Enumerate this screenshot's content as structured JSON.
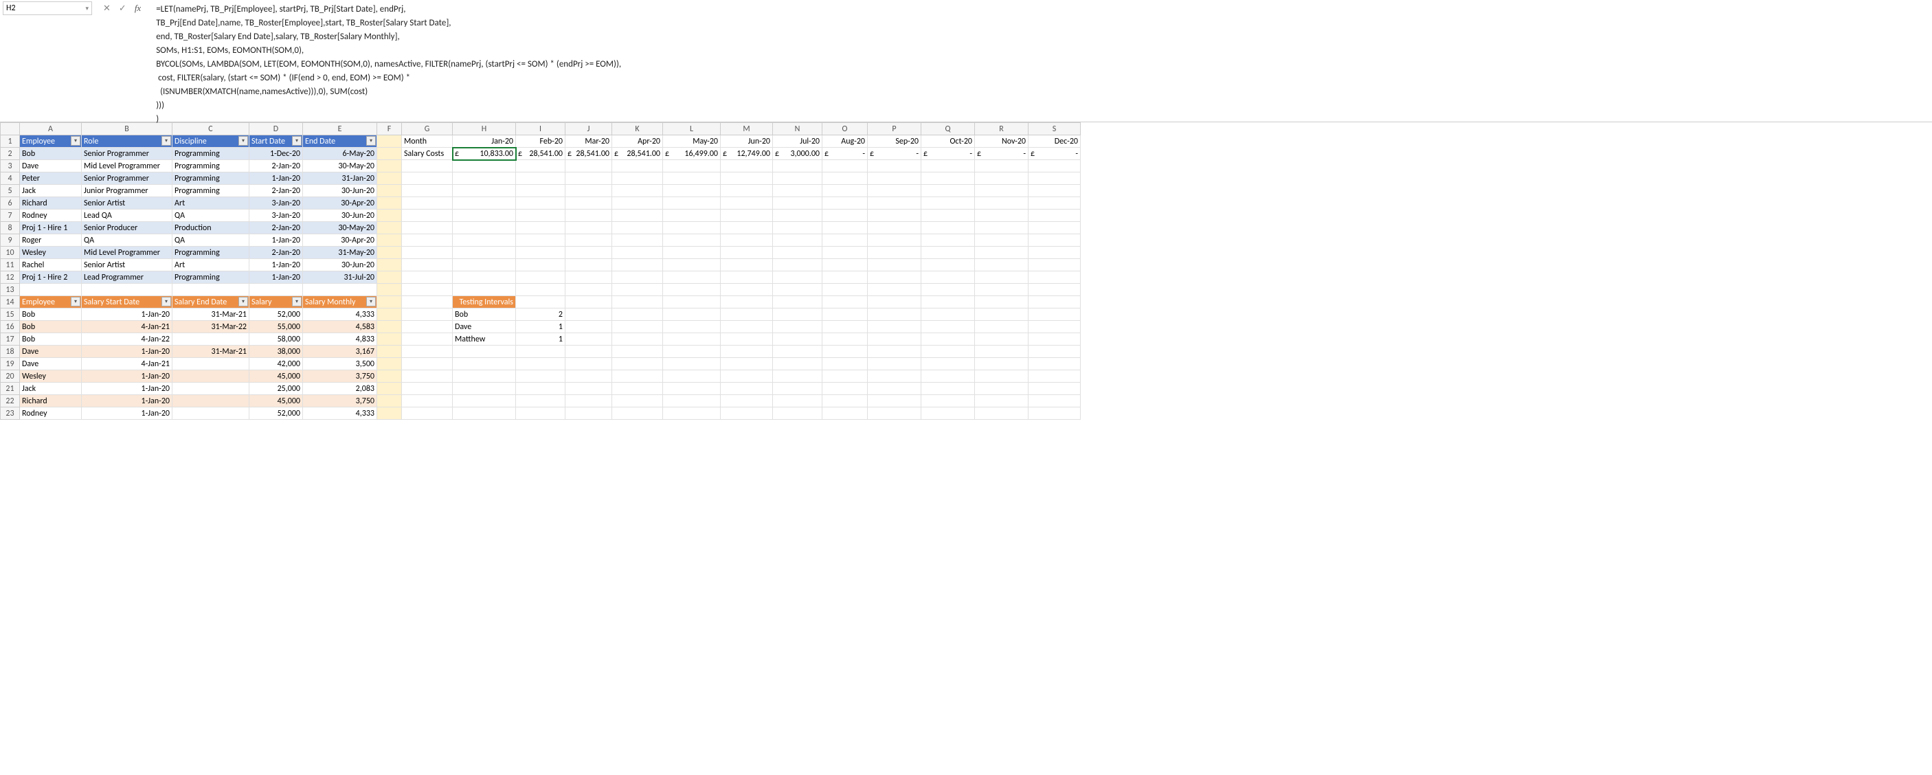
{
  "namebox": "H2",
  "formula": "=LET(namePrj, TB_Prj[Employee], startPrj, TB_Prj[Start Date], endPrj,\nTB_Prj[End Date],name, TB_Roster[Employee],start, TB_Roster[Salary Start Date],\nend, TB_Roster[Salary End Date],salary, TB_Roster[Salary Monthly],\nSOMs, H1:S1, EOMs, EOMONTH(SOM,0),\nBYCOL(SOMs, LAMBDA(SOM, LET(EOM, EOMONTH(SOM,0), namesActive, FILTER(namePrj, (startPrj <= SOM) * (endPrj >= EOM)),\n cost, FILTER(salary, (start <= SOM) * (IF(end > 0, end, EOM) >= EOM) *\n  (ISNUMBER(XMATCH(name,namesActive))),0), SUM(cost)\n)))\n)",
  "columns": [
    "A",
    "B",
    "C",
    "D",
    "E",
    "F",
    "G",
    "H",
    "I",
    "J",
    "K",
    "L",
    "M",
    "N",
    "O",
    "P",
    "Q",
    "R",
    "S"
  ],
  "table1": {
    "headers": [
      "Employee",
      "Role",
      "Discipline",
      "Start Date",
      "End Date"
    ],
    "rows": [
      [
        "Bob",
        "Senior Programmer",
        "Programming",
        "1-Dec-20",
        "6-May-20"
      ],
      [
        "Dave",
        "Mid Level Programmer",
        "Programming",
        "2-Jan-20",
        "30-May-20"
      ],
      [
        "Peter",
        "Senior Programmer",
        "Programming",
        "1-Jan-20",
        "31-Jan-20"
      ],
      [
        "Jack",
        "Junior Programmer",
        "Programming",
        "2-Jan-20",
        "30-Jun-20"
      ],
      [
        "Richard",
        "Senior Artist",
        "Art",
        "3-Jan-20",
        "30-Apr-20"
      ],
      [
        "Rodney",
        "Lead QA",
        "QA",
        "3-Jan-20",
        "30-Jun-20"
      ],
      [
        "Proj 1 - Hire 1",
        "Senior Producer",
        "Production",
        "2-Jan-20",
        "30-May-20"
      ],
      [
        "Roger",
        "QA",
        "QA",
        "1-Jan-20",
        "30-Apr-20"
      ],
      [
        "Wesley",
        "Mid Level Programmer",
        "Programming",
        "2-Jan-20",
        "31-May-20"
      ],
      [
        "Rachel",
        "Senior Artist",
        "Art",
        "1-Jan-20",
        "30-Jun-20"
      ],
      [
        "Proj 1 - Hire 2",
        "Lead Programmer",
        "Programming",
        "1-Jan-20",
        "31-Jul-20"
      ]
    ]
  },
  "table2": {
    "headers": [
      "Employee",
      "Salary Start Date",
      "Salary End Date",
      "Salary",
      "Salary Monthly"
    ],
    "rows": [
      [
        "Bob",
        "1-Jan-20",
        "31-Mar-21",
        "52,000",
        "4,333"
      ],
      [
        "Bob",
        "4-Jan-21",
        "31-Mar-22",
        "55,000",
        "4,583"
      ],
      [
        "Bob",
        "4-Jan-22",
        "",
        "58,000",
        "4,833"
      ],
      [
        "Dave",
        "1-Jan-20",
        "31-Mar-21",
        "38,000",
        "3,167"
      ],
      [
        "Dave",
        "4-Jan-21",
        "",
        "42,000",
        "3,500"
      ],
      [
        "Wesley",
        "1-Jan-20",
        "",
        "45,000",
        "3,750"
      ],
      [
        "Jack",
        "1-Jan-20",
        "",
        "25,000",
        "2,083"
      ],
      [
        "Richard",
        "1-Jan-20",
        "",
        "45,000",
        "3,750"
      ],
      [
        "Rodney",
        "1-Jan-20",
        "",
        "52,000",
        "4,333"
      ]
    ]
  },
  "months_label": "Month",
  "salary_label": "Salary Costs",
  "months": [
    "Jan-20",
    "Feb-20",
    "Mar-20",
    "Apr-20",
    "May-20",
    "Jun-20",
    "Jul-20",
    "Aug-20",
    "Sep-20",
    "Oct-20",
    "Nov-20",
    "Dec-20"
  ],
  "salary_costs": [
    "£     10,833.00",
    "£ 28,541.00",
    "£28,541.00",
    "£28,541.00",
    "£        16,499.00",
    "£ 12,749.00",
    "£  3,000.00",
    "£             -",
    "£             -",
    "£             -",
    "£             -",
    "£             -"
  ],
  "testing_intervals": {
    "title": "Testing Intervals",
    "rows": [
      [
        "Bob",
        "2"
      ],
      [
        "Dave",
        "1"
      ],
      [
        "Matthew",
        "1"
      ]
    ]
  }
}
